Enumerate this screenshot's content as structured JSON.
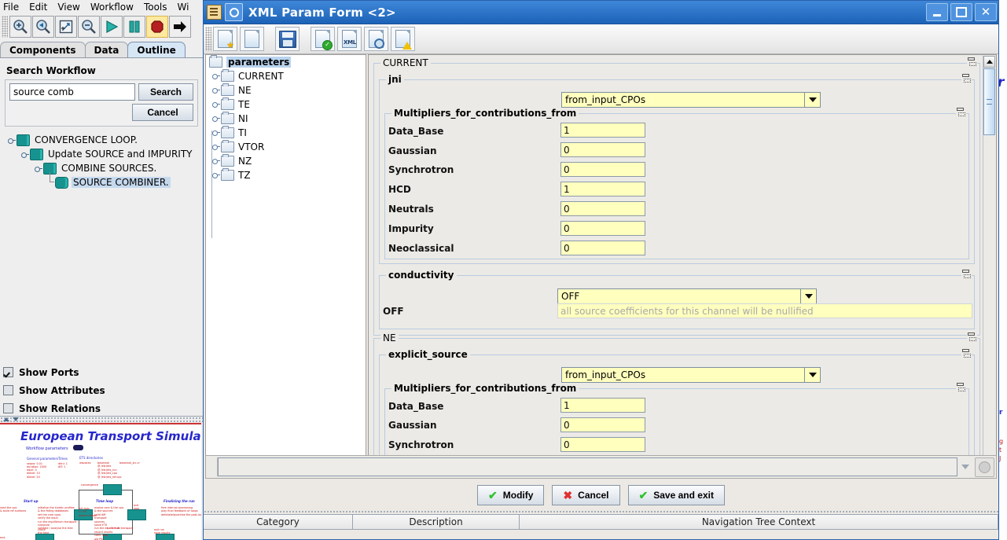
{
  "host": {
    "menus": [
      "File",
      "Edit",
      "View",
      "Workflow",
      "Tools",
      "Wi"
    ],
    "toolbar": [
      {
        "name": "zoom-in-icon",
        "glyph": "+"
      },
      {
        "name": "zoom-fit-back-icon",
        "glyph": "<"
      },
      {
        "name": "zoom-reset-icon",
        "glyph": "fit"
      },
      {
        "name": "zoom-out-icon",
        "glyph": "-"
      },
      {
        "name": "run-icon",
        "glyph": "play"
      },
      {
        "name": "pause-icon",
        "glyph": "pause"
      },
      {
        "name": "stop-icon",
        "glyph": "stop"
      },
      {
        "name": "step-icon",
        "glyph": "arrow"
      }
    ],
    "tabs": [
      {
        "label": "Components",
        "selected": false
      },
      {
        "label": "Data",
        "selected": false
      },
      {
        "label": "Outline",
        "selected": true
      }
    ],
    "search": {
      "group_title": "Search Workflow",
      "value": "source comb",
      "search_button": "Search",
      "cancel_button": "Cancel"
    },
    "tree": [
      {
        "label": "CONVERGENCE   LOOP.",
        "depth": 0,
        "selected": false
      },
      {
        "label": "Update SOURCE and IMPURITY",
        "depth": 1,
        "selected": false
      },
      {
        "label": "COMBINE SOURCES.",
        "depth": 2,
        "selected": false
      },
      {
        "label": "SOURCE COMBINER.",
        "depth": 3,
        "selected": true
      }
    ],
    "options": [
      {
        "label": "Show Ports",
        "checked": true
      },
      {
        "label": "Show Attributes",
        "checked": false
      },
      {
        "label": "Show Relations",
        "checked": false
      }
    ],
    "thumbnail": {
      "title": "European Transport Simulator",
      "caption": "Workflow parameters",
      "labels": [
        "General parameters",
        "Times",
        "ETS directories",
        "Start up",
        "Time loop",
        "Finalising the run"
      ]
    }
  },
  "window": {
    "title": "XML Param Form <2>",
    "buttons": {
      "minimize": "–",
      "maximize": "□",
      "close": "✕"
    },
    "toolbar": [
      {
        "name": "new-document-icon"
      },
      {
        "name": "open-document-icon"
      },
      {
        "name": "save-icon"
      },
      {
        "name": "validate-document-icon"
      },
      {
        "name": "xml-view-icon"
      },
      {
        "name": "preview-document-icon"
      },
      {
        "name": "warnings-icon"
      }
    ]
  },
  "nav_tree": {
    "root": "parameters",
    "nodes": [
      "CURRENT",
      "NE",
      "TE",
      "NI",
      "TI",
      "VTOR",
      "NZ",
      "TZ"
    ]
  },
  "form": {
    "sections": [
      {
        "title": "CURRENT",
        "groups": [
          {
            "title": "jni",
            "combo_value": "from_input_CPOs",
            "sub_title": "Multipliers_for_contributions_from",
            "fields": [
              {
                "label": "Data_Base",
                "value": "1"
              },
              {
                "label": "Gaussian",
                "value": "0"
              },
              {
                "label": "Synchrotron",
                "value": "0"
              },
              {
                "label": "HCD",
                "value": "1"
              },
              {
                "label": "Neutrals",
                "value": "0"
              },
              {
                "label": "Impurity",
                "value": "0"
              },
              {
                "label": "Neoclassical",
                "value": "0"
              }
            ]
          },
          {
            "title": "conductivity",
            "combo_value": "OFF",
            "note_label": "OFF",
            "note_value": "all source coefficients for this channel will be nullified"
          }
        ]
      },
      {
        "title": "NE",
        "groups": [
          {
            "title": "explicit_source",
            "combo_value": "from_input_CPOs",
            "sub_title": "Multipliers_for_contributions_from",
            "fields": [
              {
                "label": "Data_Base",
                "value": "1"
              },
              {
                "label": "Gaussian",
                "value": "0"
              },
              {
                "label": "Synchrotron",
                "value": "0"
              }
            ]
          }
        ]
      }
    ]
  },
  "bottom": {
    "edit_value": "",
    "buttons": [
      {
        "label": "Modify",
        "icon": "check-icon"
      },
      {
        "label": "Cancel",
        "icon": "x-icon"
      },
      {
        "label": "Save and exit",
        "icon": "check-icon"
      }
    ],
    "table_headers": [
      "Category",
      "Description",
      "Navigation Tree Context"
    ]
  },
  "colors": {
    "field_yellow": "#ffffbe",
    "title_blue": "#1c63b8",
    "selection_blue": "#b9d3ee",
    "node_teal": "#17938f"
  }
}
